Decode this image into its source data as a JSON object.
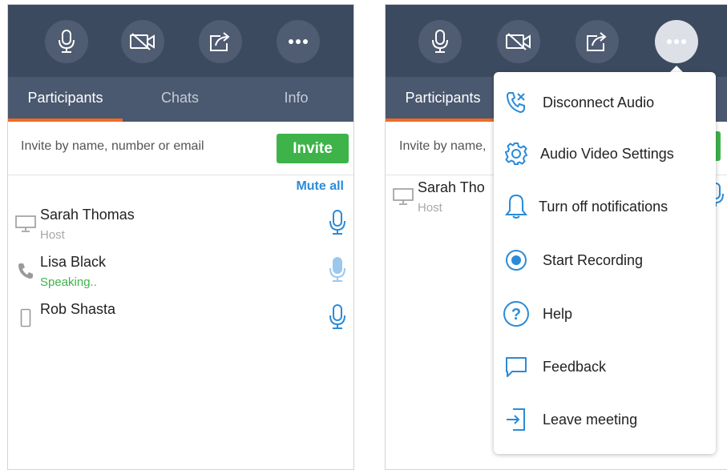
{
  "left": {
    "tabs": [
      {
        "label": "Participants"
      },
      {
        "label": "Chats"
      },
      {
        "label": "Info"
      }
    ],
    "invite": {
      "placeholder": "Invite by name, number or email",
      "button_label": "Invite"
    },
    "mute_all_label": "Mute all",
    "participants": [
      {
        "name": "Sarah Thomas",
        "status": "Host",
        "device_icon": "monitor-icon"
      },
      {
        "name": "Lisa Black",
        "status": "Speaking..",
        "device_icon": "phone-icon"
      },
      {
        "name": "Rob Shasta",
        "status": "",
        "device_icon": "mobile-icon"
      }
    ]
  },
  "right": {
    "tabs": [
      {
        "label": "Participants"
      }
    ],
    "invite": {
      "placeholder": "Invite by name,"
    },
    "participants": [
      {
        "name": "Sarah Tho",
        "status": "Host"
      }
    ],
    "menu": {
      "items": [
        {
          "label": "Disconnect Audio",
          "icon": "disconnect-audio-icon"
        },
        {
          "label": "Audio Video Settings",
          "icon": "gear-icon"
        },
        {
          "label": "Turn off notifications",
          "icon": "bell-icon"
        },
        {
          "label": "Start Recording",
          "icon": "record-icon"
        },
        {
          "label": "Help",
          "icon": "help-icon"
        },
        {
          "label": "Feedback",
          "icon": "chat-bubble-icon"
        },
        {
          "label": "Leave meeting",
          "icon": "leave-meeting-icon"
        }
      ]
    }
  },
  "toolbar": {
    "buttons": [
      "microphone-icon",
      "video-off-icon",
      "share-icon",
      "more-icon"
    ]
  },
  "colors": {
    "toolbar_bg": "#3c4a60",
    "tabbar_bg": "#4a5870",
    "tab_accent": "#f26b22",
    "invite_green": "#3db34a",
    "link_blue": "#2b8bd8",
    "mic_blue": "#2b8bd8"
  }
}
